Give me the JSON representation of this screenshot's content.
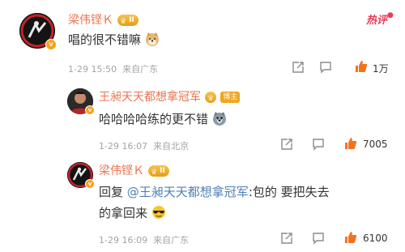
{
  "hot_label": "热评",
  "comments": [
    {
      "user": "梁伟铿Ｋ",
      "level": "II",
      "text": "唱的很不错嘛",
      "emoji": "doge-emoji",
      "time": "1-29 15:50",
      "location": "来自广东",
      "likes": "1万"
    },
    {
      "user": "王昶天天都想拿冠军",
      "badge": "博主",
      "text": "哈哈哈哈练的更不错",
      "emoji": "husky-emoji",
      "time": "1-29 16:07",
      "location": "来自北京",
      "likes": "7005"
    },
    {
      "user": "梁伟铿Ｋ",
      "level": "II",
      "reply_prefix": "回复",
      "reply_to": "@王昶天天都想拿冠军",
      "text_line1": ":包的 要把失去",
      "text_line2": "的拿回来",
      "emoji": "cool-sunglasses-emoji",
      "time": "1-29 16:09",
      "location": "来自广东",
      "likes": "6100"
    }
  ],
  "colors": {
    "username": "#eb7350",
    "mention": "#4d7fb8",
    "like_icon": "#f2731f",
    "hot": "#ee3b57"
  }
}
